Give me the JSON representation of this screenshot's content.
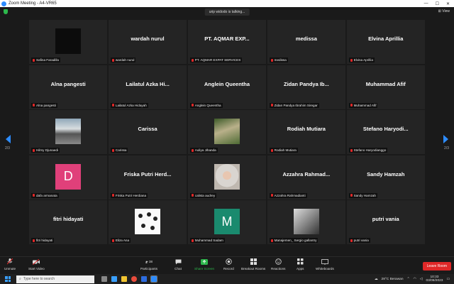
{
  "window": {
    "title": "Zoom Meeting - A4-VR65",
    "controls": [
      "—",
      "☐",
      "✕"
    ]
  },
  "meeting": {
    "talking_indicator": "urip widodo is talking...",
    "view_label": "View",
    "page_left": "2/3",
    "page_right": "2/3"
  },
  "participants": [
    {
      "display": "",
      "label": "Safina Faradilla",
      "media": "dark-video"
    },
    {
      "display": "wardah nurul",
      "label": "wardah nurul"
    },
    {
      "display": "PT. AQMAR EXP...",
      "label": "PT. AQMAR EXPAT SERVICES"
    },
    {
      "display": "medissa",
      "label": "medissa"
    },
    {
      "display": "Elvina Aprillia",
      "label": "Elvina Aprillia"
    },
    {
      "display": "Alna pangesti",
      "label": "Alna pangesti"
    },
    {
      "display": "Lailatul Azka Hi...",
      "label": "Lailatul Azka Hidayah"
    },
    {
      "display": "Anglein Queentha",
      "label": "Anglein Queentha"
    },
    {
      "display": "Zidan Pandya Ib...",
      "label": "Zidan Pandya Ibrahim Siregar"
    },
    {
      "display": "Muhammad Afif",
      "label": "Muhammad Afif"
    },
    {
      "display": "",
      "label": "Hilmy Djunaedi",
      "media": "photo-person"
    },
    {
      "display": "Carissa",
      "label": "Carissa"
    },
    {
      "display": "",
      "label": "Auliya Jihanda",
      "media": "photo-outdoor"
    },
    {
      "display": "Rodiah Mutiara",
      "label": "Rodiah Mutiara"
    },
    {
      "display": "Stefano Haryodi...",
      "label": "Stefano Haryodianggo"
    },
    {
      "display": "",
      "label": "dafa armanata",
      "media": "letter",
      "letter": "D",
      "color": "#e0407a"
    },
    {
      "display": "Friska Putri Herd...",
      "label": "Friska Putri Herdiana"
    },
    {
      "display": "",
      "label": "calista audrey",
      "media": "photo-hijab"
    },
    {
      "display": "Azzahra Rahmad...",
      "label": "Azzahra Rahmadianti"
    },
    {
      "display": "Sandy Hamzah",
      "label": "Sandy Hamzah"
    },
    {
      "display": "fitri hidayati",
      "label": "fitri hidayati"
    },
    {
      "display": "",
      "label": "Eliza Ana",
      "media": "photo-collage"
    },
    {
      "display": "",
      "label": "Muhammad Sadam",
      "media": "letter",
      "letter": "M",
      "color": "#1a8a6e"
    },
    {
      "display": "",
      "label": "Manajemen_ Sergio gallantry",
      "media": "photo-room"
    },
    {
      "display": "putri vania",
      "label": "putri vania"
    }
  ],
  "toolbar": {
    "unmute": "Unmute",
    "start_video": "Start Video",
    "participants": "Participants",
    "participants_count": "38",
    "chat": "Chat",
    "share_screen": "Share Screen",
    "record": "Record",
    "breakout": "Breakout Rooms",
    "reactions": "Reactions",
    "apps": "Apps",
    "whiteboards": "Whiteboards",
    "leave": "Leave Room"
  },
  "taskbar": {
    "search_placeholder": "Type here to search",
    "weather": "28°C  Berawan",
    "time": "10:33",
    "date": "03/06/2023"
  },
  "colors": {
    "accent": "#2d8cff",
    "mute": "#e02828",
    "share": "#2db84c"
  }
}
